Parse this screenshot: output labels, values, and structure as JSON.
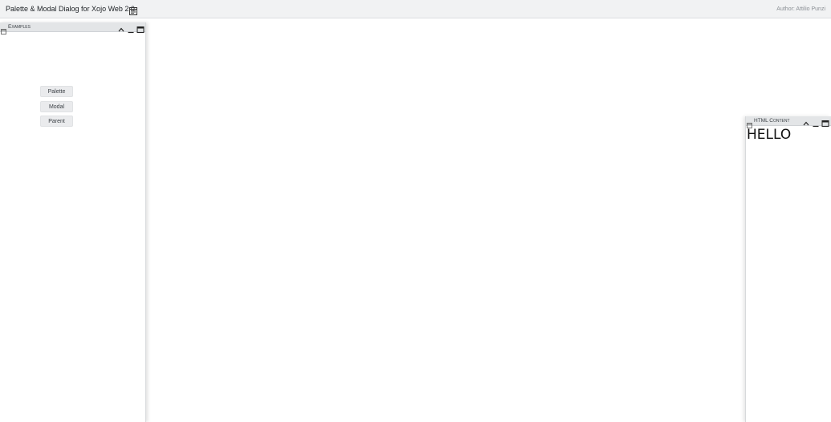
{
  "header": {
    "title": "Palette & Modal Dialog for Xojo Web 2.0",
    "title_icon": "document-list-icon",
    "author": "Author: Attilio Punzi"
  },
  "panels": {
    "examples": {
      "title": "Examples",
      "icon": "window-icon",
      "controls": [
        "collapse-icon",
        "minimize-icon",
        "maximize-icon"
      ],
      "buttons": {
        "palette": "Palette",
        "modal": "Modal",
        "parent": "Parent"
      }
    },
    "html_content": {
      "title": "HTML Content",
      "icon": "window-icon",
      "controls": [
        "collapse-icon",
        "minimize-icon",
        "maximize-icon"
      ],
      "body_text": "HELLO"
    }
  },
  "colors": {
    "topbar_bg": "#f1f2f3",
    "panel_titlebar_bg": "#e3e5e7",
    "button_bg": "#eaebed"
  }
}
